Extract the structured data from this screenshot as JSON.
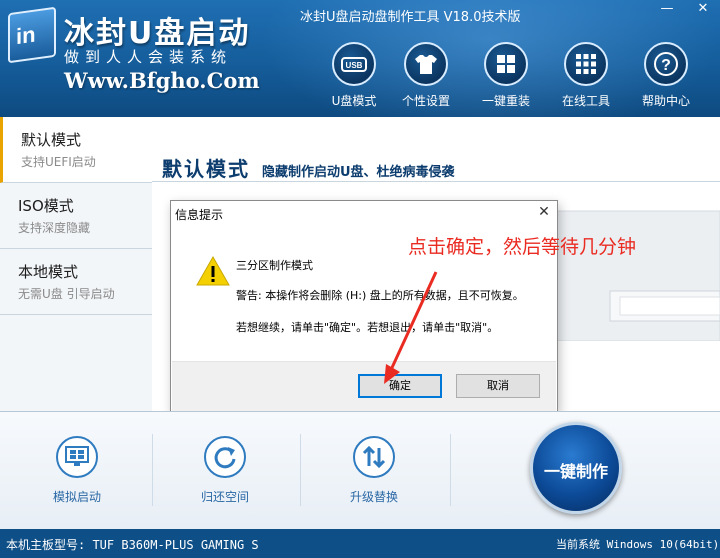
{
  "window": {
    "title": "冰封U盘启动盘制作工具 V18.0技术版",
    "minimize_symbol": "—",
    "close_symbol": "✕"
  },
  "brand": {
    "logo_text": "in",
    "title": "冰封U盘启动",
    "subtitle": "做到人人会装系统",
    "url": "Www.Bfgho.Com"
  },
  "nav": [
    {
      "label": "U盘模式",
      "icon": "usb-icon"
    },
    {
      "label": "个性设置",
      "icon": "tshirt-icon"
    },
    {
      "label": "一键重装",
      "icon": "windows-icon"
    },
    {
      "label": "在线工具",
      "icon": "grid-icon"
    },
    {
      "label": "帮助中心",
      "icon": "question-icon"
    }
  ],
  "sidebar": {
    "items": [
      {
        "title": "默认模式",
        "subtitle": "支持UEFI启动",
        "active": true
      },
      {
        "title": "ISO模式",
        "subtitle": "支持深度隐藏",
        "active": false
      },
      {
        "title": "本地模式",
        "subtitle": "无需U盘 引导启动",
        "active": false
      }
    ]
  },
  "content": {
    "title": "默认模式",
    "subtitle": "隐藏制作启动U盘、杜绝病毒侵袭"
  },
  "dialog": {
    "title": "信息提示",
    "close_symbol": "✕",
    "icon": "warning-icon",
    "line1": "三分区制作模式",
    "line2": "警告: 本操作将会删除 (H:) 盘上的所有数据，且不可恢复。",
    "line3": "若想继续，请单击\"确定\"。若想退出，请单击\"取消\"。",
    "ok_label": "确定",
    "cancel_label": "取消"
  },
  "annotation": {
    "text": "点击确定，然后等待几分钟",
    "color": "#ea2b22"
  },
  "tools": [
    {
      "label": "模拟启动",
      "icon": "monitor-icon"
    },
    {
      "label": "归还空间",
      "icon": "refresh-icon"
    },
    {
      "label": "升级替换",
      "icon": "swap-arrows-icon"
    }
  ],
  "make_button": {
    "label": "一键制作"
  },
  "status": {
    "left": "本机主板型号: TUF B360M-PLUS GAMING S",
    "right": "当前系统 Windows 10(64bit)"
  },
  "colors": {
    "header_blue": "#155d9b",
    "title_navy": "#0c3d6e",
    "active_accent": "#e9a400",
    "link_blue": "#2b68a5"
  }
}
